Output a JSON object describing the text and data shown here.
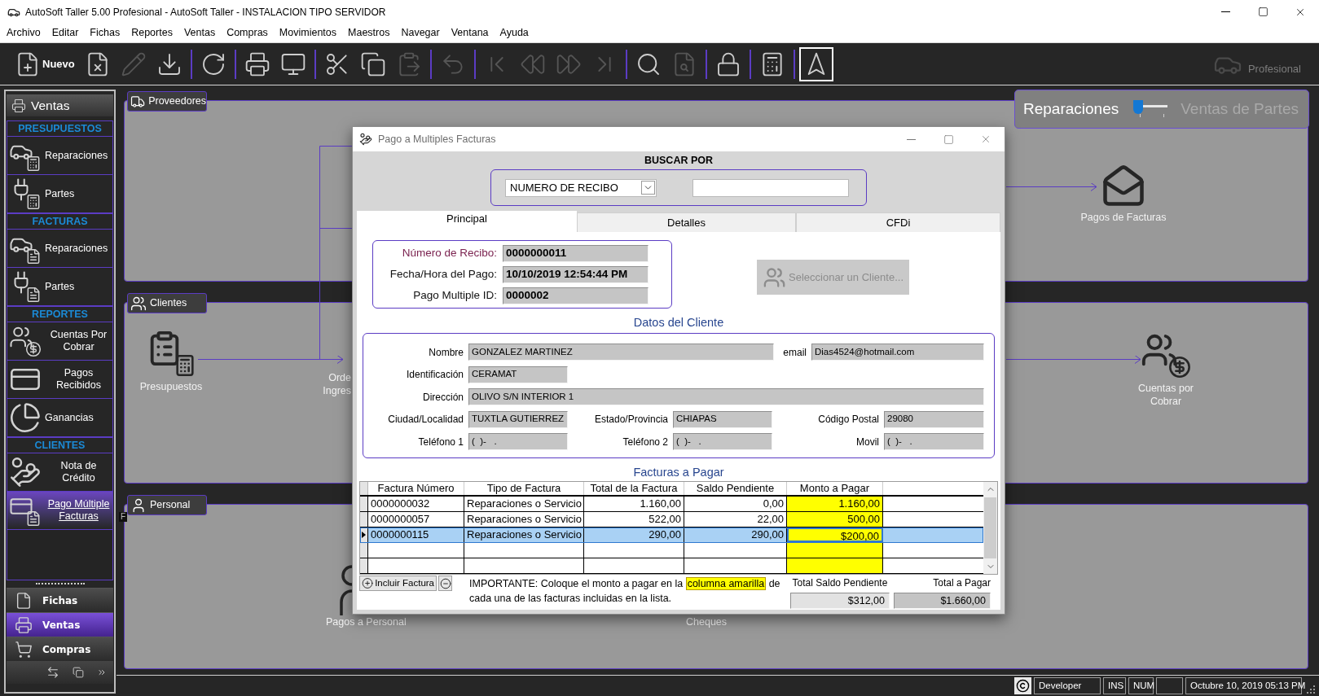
{
  "window": {
    "title": "AutoSoft Taller 5.00 Profesional - AutoSoft Taller - INSTALACION TIPO SERVIDOR"
  },
  "menu": [
    "Archivo",
    "Editar",
    "Fichas",
    "Reportes",
    "Ventas",
    "Compras",
    "Movimientos",
    "Maestros",
    "Navegar",
    "Ventana",
    "Ayuda"
  ],
  "toolbar": {
    "groups": [
      [
        {
          "label": "Nuevo",
          "disabled": false,
          "pressed": false
        },
        {
          "disabled": false,
          "pressed": false
        },
        {
          "disabled": true,
          "pressed": false
        },
        {
          "disabled": false,
          "pressed": false
        }
      ],
      [
        {
          "disabled": false,
          "pressed": false
        }
      ],
      [
        {
          "disabled": false,
          "pressed": false
        },
        {
          "disabled": false,
          "pressed": false
        }
      ],
      [
        {
          "disabled": false,
          "pressed": false
        },
        {
          "disabled": false,
          "pressed": false
        },
        {
          "disabled": true,
          "pressed": false
        }
      ],
      [
        {
          "disabled": true,
          "pressed": false
        }
      ],
      [
        {
          "disabled": true,
          "pressed": false
        },
        {
          "disabled": true,
          "pressed": false
        },
        {
          "disabled": true,
          "pressed": false
        },
        {
          "disabled": true,
          "pressed": false
        }
      ],
      [
        {
          "disabled": false,
          "pressed": false
        },
        {
          "disabled": true,
          "pressed": false
        }
      ],
      [
        {
          "disabled": false,
          "pressed": false
        }
      ],
      [
        {
          "disabled": false,
          "pressed": false
        }
      ],
      [
        {
          "disabled": false,
          "pressed": true
        }
      ]
    ],
    "edition": "Profesional"
  },
  "sidebar": {
    "title": "Ventas",
    "sections": [
      {
        "heading": "PRESUPUESTOS",
        "items": [
          {
            "label": "Reparaciones",
            "selected": false
          },
          {
            "label": "Partes",
            "selected": false
          }
        ]
      },
      {
        "heading": "FACTURAS",
        "items": [
          {
            "label": "Reparaciones",
            "selected": false
          },
          {
            "label": "Partes",
            "selected": false
          }
        ]
      },
      {
        "heading": "REPORTES",
        "items": [
          {
            "label": "Cuentas Por Cobrar",
            "selected": false
          },
          {
            "label": "Pagos Recibidos",
            "selected": false
          },
          {
            "label": "Ganancias",
            "selected": false
          }
        ]
      },
      {
        "heading": "CLIENTES",
        "items": [
          {
            "label": "Nota de Crédito",
            "selected": false
          },
          {
            "label": "Pago Múltiple Facturas",
            "selected": true
          }
        ]
      }
    ],
    "modules": [
      {
        "label": "Fichas",
        "selected": false
      },
      {
        "label": "Ventas",
        "selected": true
      },
      {
        "label": "Compras",
        "selected": false
      }
    ]
  },
  "tooltip": "F",
  "canvas": {
    "mode_switch": {
      "options": [
        {
          "label": "Reparaciones",
          "selected": true
        },
        {
          "label": "Ventas de Partes",
          "selected": false
        }
      ]
    },
    "panels": [
      {
        "title": "Proveedores",
        "nodes": [
          {
            "label": "Pagos de Facturas"
          }
        ]
      },
      {
        "title": "Clientes",
        "nodes": [
          {
            "label": "Presupuestos"
          },
          {
            "label": "Orde Ingres"
          },
          {
            "label": "Cuentas por Cobrar"
          }
        ]
      },
      {
        "title": "Personal",
        "nodes": [
          {
            "label": "Pagos a Personal"
          },
          {
            "label": "Cheques"
          }
        ]
      }
    ]
  },
  "dialog": {
    "title": "Pago a Multiples Facturas",
    "search": {
      "heading": "BUSCAR POR",
      "criterion": "NUMERO DE RECIBO"
    },
    "tabs": [
      {
        "label": "Principal",
        "selected": true
      },
      {
        "label": "Detalles",
        "selected": false
      },
      {
        "label": "CFDi",
        "selected": false
      }
    ],
    "receipt": [
      {
        "label": "Número de Recibo:",
        "value": "0000000011",
        "color": "#7b2350"
      },
      {
        "label": "Fecha/Hora del Pago:",
        "value": "10/10/2019 12:54:44 PM",
        "color": "#111111"
      },
      {
        "label": "Pago Multiple ID:",
        "value": "0000002",
        "color": "#111111"
      }
    ],
    "select_client": {
      "label": "Seleccionar un Cliente...",
      "disabled": true
    },
    "client": {
      "heading": "Datos del Cliente",
      "fields": [
        {
          "label": "Nombre",
          "value": "GONZALEZ MARTINEZ"
        },
        {
          "label": "email",
          "value": "Dias4524@hotmail.com"
        },
        {
          "label": "Identificación",
          "value": "CERAMAT"
        },
        {
          "label": "Dirección",
          "value": "OLIVO S/N INTERIOR 1"
        },
        {
          "label": "Ciudad/Localidad",
          "value": "TUXTLA GUTIERREZ"
        },
        {
          "label": "Estado/Provincia",
          "value": "CHIAPAS"
        },
        {
          "label": "Código Postal",
          "value": "29080"
        },
        {
          "label": "Teléfono 1",
          "value": "(  )-   ."
        },
        {
          "label": "Teléfono 2",
          "value": "(  )-   ."
        },
        {
          "label": "Movil",
          "value": "(  )-   ."
        }
      ]
    },
    "invoices": {
      "heading": "Facturas a Pagar",
      "columns": [
        "Factura Número",
        "Tipo de Factura",
        "Total de la Factura",
        "Saldo Pendiente",
        "Monto a Pagar"
      ],
      "rows": [
        {
          "cells": [
            "0000000032",
            "Reparaciones o Servicio",
            "1.160,00",
            "0,00",
            "1.160,00"
          ],
          "selected": false
        },
        {
          "cells": [
            "0000000057",
            "Reparaciones o Servicio",
            "522,00",
            "22,00",
            "500,00"
          ],
          "selected": false
        },
        {
          "cells": [
            "0000000115",
            "Reparaciones o Servicio",
            "290,00",
            "290,00",
            "$200,00"
          ],
          "selected": true
        }
      ]
    },
    "add_button": "Incluir Factura",
    "note": {
      "before": "IMPORTANTE: Coloque el monto a pagar en la",
      "highlight": "columna amarilla",
      "after": "de cada una de las facturas incluidas en la lista."
    },
    "totals": [
      {
        "label": "Total Saldo Pendiente",
        "value": "$312,00"
      },
      {
        "label": "Total a Pagar",
        "value": "$1.660,00"
      }
    ]
  },
  "status_bar": {
    "panels": [
      "Developer",
      "INS",
      "NUM"
    ],
    "datetime": "Octubre 10, 2019 05:13 PM"
  }
}
